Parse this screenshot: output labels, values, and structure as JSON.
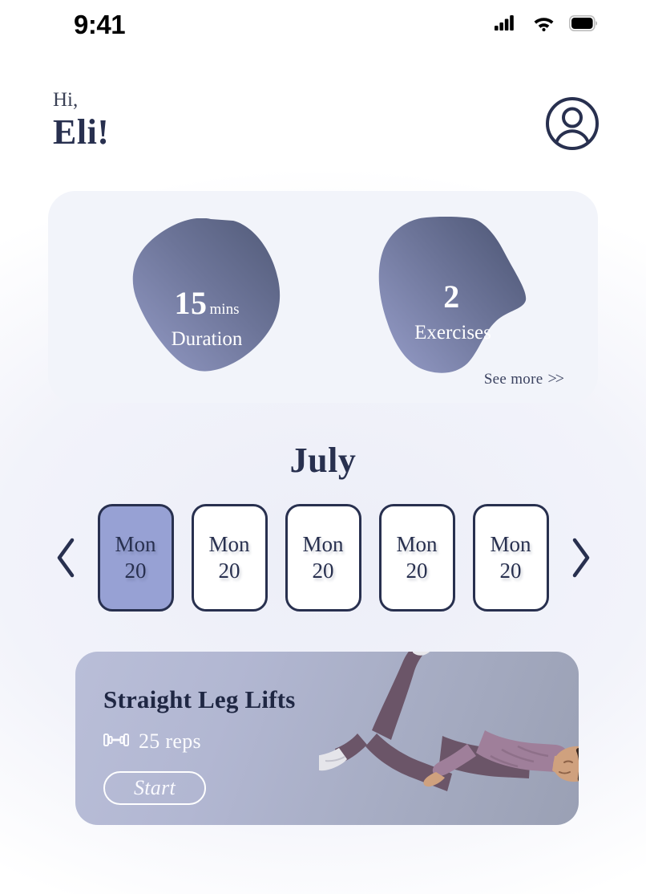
{
  "status_bar": {
    "time": "9:41",
    "cellular_icon": "cellular-signal-icon",
    "wifi_icon": "wifi-icon",
    "battery_icon": "battery-icon"
  },
  "header": {
    "greeting": "Hi,",
    "user_name": "Eli!",
    "avatar_icon": "user-avatar-icon"
  },
  "stats": {
    "items": [
      {
        "value": "15",
        "unit": "mins",
        "label": "Duration"
      },
      {
        "value": "2",
        "unit": "",
        "label": "Exercises"
      }
    ],
    "see_more": "See more",
    "see_more_chevrons": ">>"
  },
  "calendar": {
    "month": "July",
    "prev_icon": "chevron-left-icon",
    "next_icon": "chevron-right-icon",
    "days": [
      {
        "dow": "Mon",
        "num": "20",
        "selected": true
      },
      {
        "dow": "Mon",
        "num": "20",
        "selected": false
      },
      {
        "dow": "Mon",
        "num": "20",
        "selected": false
      },
      {
        "dow": "Mon",
        "num": "20",
        "selected": false
      },
      {
        "dow": "Mon",
        "num": "20",
        "selected": false
      }
    ]
  },
  "workout": {
    "title": "Straight Leg Lifts",
    "reps": "25 reps",
    "reps_icon": "dumbbell-icon",
    "start_label": "Start",
    "photo": "person-doing-leg-lift-photo"
  },
  "colors": {
    "navy": "#28304f",
    "periwinkle": "#97a1d4",
    "blob_dark": "#4f5877",
    "blob_light": "#8f97c2",
    "card_bg": "#f2f4fa",
    "page_bg": "#ffffff"
  }
}
